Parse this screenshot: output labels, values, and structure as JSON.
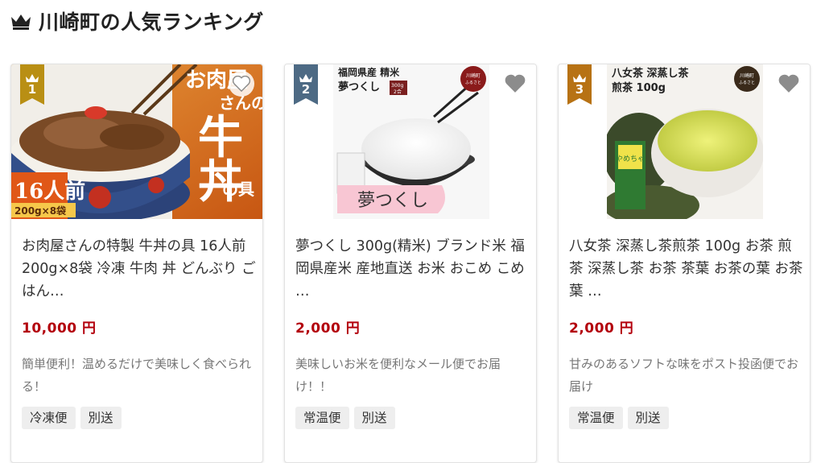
{
  "header": {
    "title": "川崎町の人気ランキング",
    "icon": "crown-icon"
  },
  "colors": {
    "rank1": "#b98f14",
    "rank2": "#4d6a84",
    "rank3": "#b77214",
    "price": "#b3000c"
  },
  "cards": [
    {
      "rank": "1",
      "name": "お肉屋さんの特製 牛丼の具 16人前 200g×8袋 冷凍 牛肉 丼 どんぶり ごはん…",
      "price": "10,000 円",
      "description": "簡単便利！温めるだけで美味しく食べられる！",
      "tags": [
        "冷凍便",
        "別送"
      ],
      "image_text": {
        "headline_a": "お肉屋さんの",
        "headline_b": "牛丼",
        "headline_c": "の具",
        "portions": "16人前",
        "pack": "200g×8袋"
      }
    },
    {
      "rank": "2",
      "name": "夢つくし 300g(精米) ブランド米 福岡県産米 産地直送 お米 おこめ こめ …",
      "price": "2,000 円",
      "description": "美味しいお米を便利なメール便でお届け！！",
      "tags": [
        "常温便",
        "別送"
      ],
      "image_text": {
        "line1": "福岡県産 精米",
        "line2": "夢つくし",
        "weight": "300g",
        "servings": "2合",
        "logo": "夢つくし",
        "seal": "川崎町ふるさと納税"
      }
    },
    {
      "rank": "3",
      "name": "八女茶 深蒸し茶煎茶 100g お茶 煎茶 深蒸し茶 お茶 茶葉 お茶の葉 お茶葉 …",
      "price": "2,000 円",
      "description": "甘みのあるソフトな味をポスト投函便でお届け",
      "tags": [
        "常温便",
        "別送"
      ],
      "image_text": {
        "line1": "八女茶 深蒸し茶",
        "line2": "煎茶 100g",
        "package": "やめちゃ",
        "seal": "川崎町ふるさと納税"
      }
    }
  ]
}
